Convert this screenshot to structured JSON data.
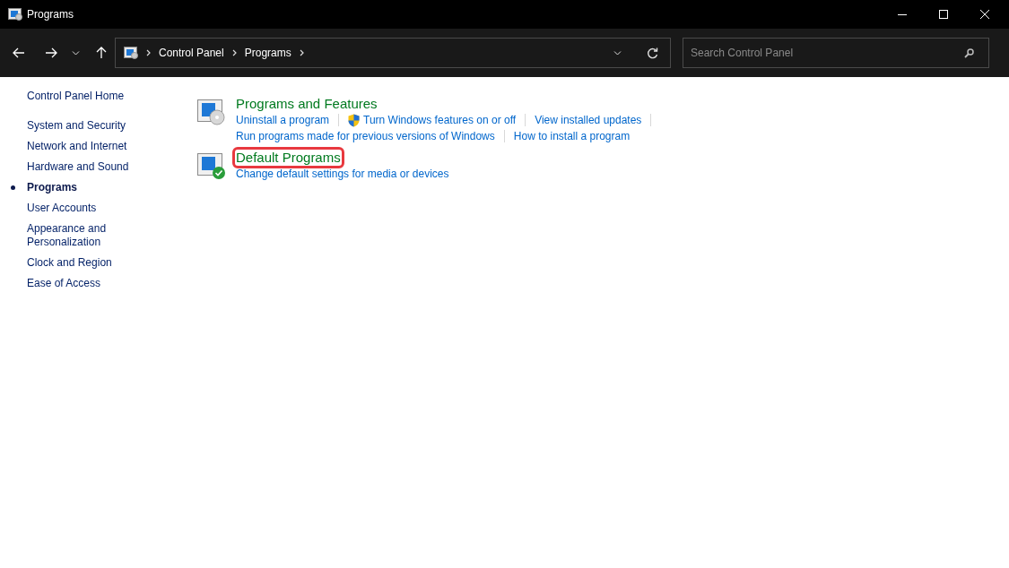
{
  "window": {
    "title": "Programs"
  },
  "address_bar": {
    "breadcrumbs": [
      "Control Panel",
      "Programs"
    ]
  },
  "search": {
    "placeholder": "Search Control Panel"
  },
  "sidebar": {
    "home": "Control Panel Home",
    "items": [
      {
        "label": "System and Security",
        "selected": false
      },
      {
        "label": "Network and Internet",
        "selected": false
      },
      {
        "label": "Hardware and Sound",
        "selected": false
      },
      {
        "label": "Programs",
        "selected": true
      },
      {
        "label": "User Accounts",
        "selected": false
      },
      {
        "label": "Appearance and Personalization",
        "selected": false
      },
      {
        "label": "Clock and Region",
        "selected": false
      },
      {
        "label": "Ease of Access",
        "selected": false
      }
    ]
  },
  "sections": [
    {
      "kind": "programs",
      "title": "Programs and Features",
      "highlighted": false,
      "link_rows": [
        [
          {
            "label": "Uninstall a program",
            "shield": false
          },
          {
            "label": "Turn Windows features on or off",
            "shield": true
          },
          {
            "label": "View installed updates",
            "shield": false
          }
        ],
        [
          {
            "label": "Run programs made for previous versions of Windows",
            "shield": false
          },
          {
            "label": "How to install a program",
            "shield": false
          }
        ]
      ]
    },
    {
      "kind": "defaults",
      "title": "Default Programs",
      "highlighted": true,
      "link_rows": [
        [
          {
            "label": "Change default settings for media or devices",
            "shield": false
          }
        ]
      ]
    }
  ]
}
